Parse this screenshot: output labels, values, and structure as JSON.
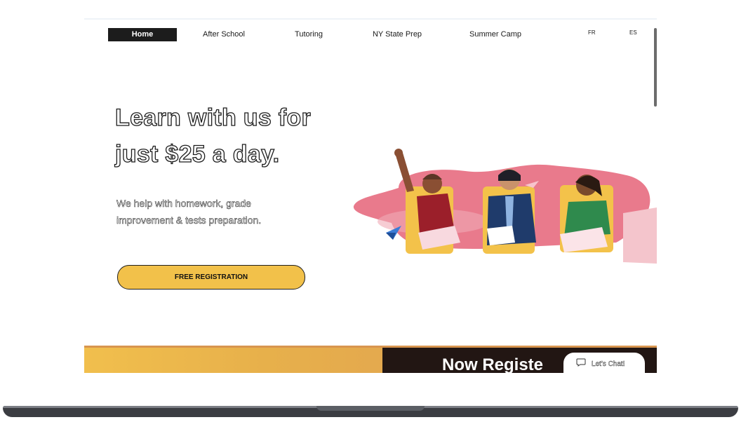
{
  "nav": {
    "items": [
      {
        "label": "Home",
        "active": true
      },
      {
        "label": "After School",
        "active": false
      },
      {
        "label": "Tutoring",
        "active": false
      },
      {
        "label": "NY State Prep",
        "active": false
      },
      {
        "label": "Summer Camp",
        "active": false
      }
    ],
    "languages": [
      "FR",
      "ES"
    ]
  },
  "hero": {
    "title_line1": "Learn with us for",
    "title_line2": "just $25 a day.",
    "subtitle_line1": "We help with homework, grade",
    "subtitle_line2": "improvement & tests preparation.",
    "cta_label": "FREE REGISTRATION"
  },
  "banner": {
    "text": "Now Registe"
  },
  "chat": {
    "label": "Let's Chat!"
  },
  "colors": {
    "accent_yellow": "#f2c14a",
    "nav_active_bg": "#1c1c1c",
    "blob_pink": "#e97a8c",
    "banner_dark": "#221613"
  },
  "icons": {
    "chat": "chat-bubble-icon",
    "paper_plane": "paper-plane-icon"
  }
}
